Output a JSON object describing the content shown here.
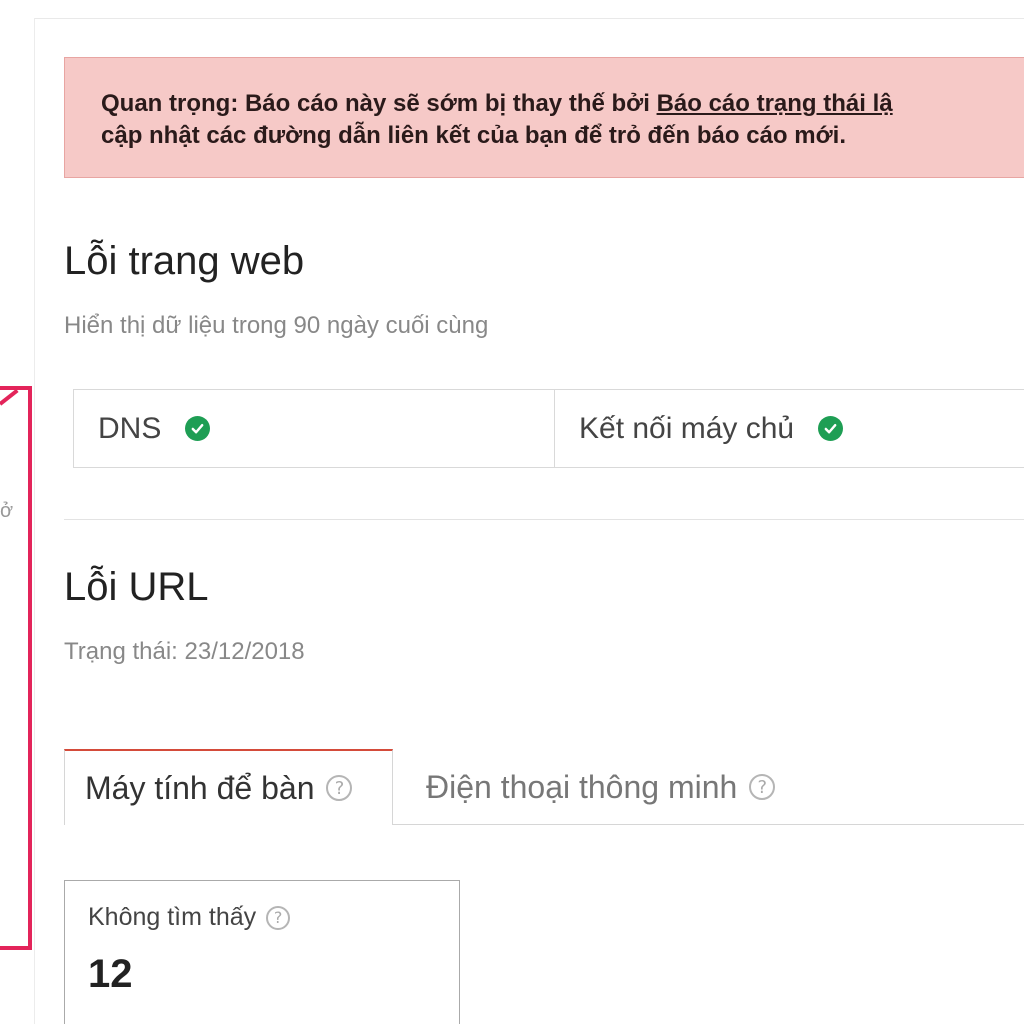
{
  "alert": {
    "prefix": "Quan trọng: Báo cáo này sẽ sớm bị thay thế bởi ",
    "link": "Báo cáo trạng thái lậ",
    "line2": "cập nhật các đường dẫn liên kết của bạn để trỏ đến báo cáo mới."
  },
  "site_errors": {
    "title": "Lỗi trang web",
    "subtitle": "Hiển thị dữ liệu trong 90 ngày cuối cùng",
    "items": [
      {
        "label": "DNS",
        "status": "ok",
        "icon": "check-circle-icon"
      },
      {
        "label": "Kết nối máy chủ",
        "status": "ok",
        "icon": "check-circle-icon"
      }
    ],
    "ok_color": "#1e9e54"
  },
  "url_errors": {
    "title": "Lỗi URL",
    "status": "Trạng thái: 23/12/2018",
    "tabs": [
      {
        "label": "Máy tính để bàn",
        "active": true
      },
      {
        "label": "Điện thoại thông minh",
        "active": false
      }
    ],
    "card": {
      "label": "Không tìm thấy",
      "value": "12"
    }
  },
  "sidebar": {
    "fragment_text": "ở"
  },
  "colors": {
    "alert_bg": "#f6c9c7",
    "highlight": "#e3245a",
    "tab_active_border": "#d44b3a"
  }
}
